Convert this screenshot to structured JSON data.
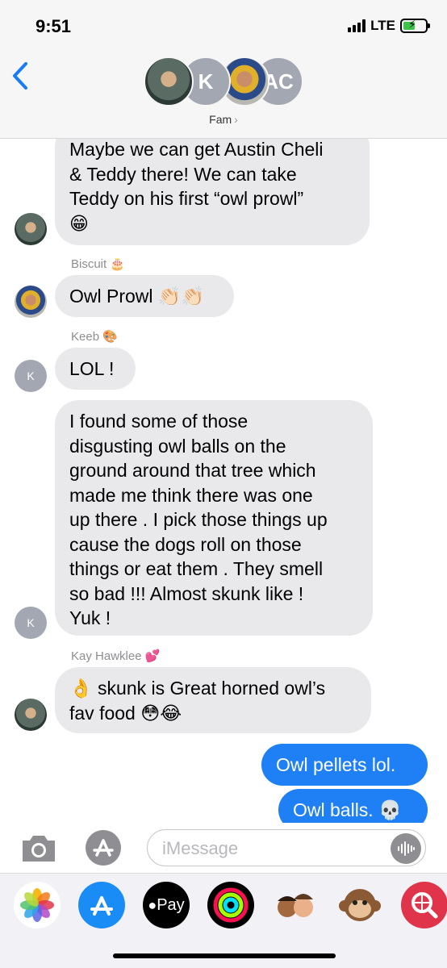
{
  "status_bar": {
    "time": "9:51",
    "network": "LTE",
    "battery_color": "#3ec34a"
  },
  "header": {
    "group_name": "Fam",
    "avatar_initials": [
      "K",
      "AC"
    ]
  },
  "messages": [
    {
      "from": "received",
      "sender_name": "",
      "avatar": "photo-diver",
      "lines": [
        "Maybe we can get Austin Cheli",
        "& Teddy there! We can take",
        "Teddy on his first “owl prowl”",
        "😁"
      ]
    },
    {
      "from": "received",
      "sender_name": "Biscuit 🎂",
      "avatar": "photo-goggles",
      "lines": [
        "Owl Prowl 👏🏻👏🏻"
      ]
    },
    {
      "from": "received",
      "sender_name": "Keeb 🎨",
      "avatar": "K",
      "lines": [
        "LOL !"
      ]
    },
    {
      "from": "received",
      "sender_name": "",
      "avatar": "K",
      "lines": [
        "I found some of those",
        "disgusting owl balls on the",
        "ground around that tree which",
        "made me think there was one",
        "up there . I pick those things up",
        "cause the dogs roll on those",
        "things or eat them . They smell",
        "so bad !!!  Almost skunk like !",
        "Yuk !"
      ]
    },
    {
      "from": "received",
      "sender_name": "Kay Hawklee 💕",
      "avatar": "photo-diver",
      "lines": [
        "👌 skunk is Great horned owl’s",
        "fav food 😳😂"
      ]
    },
    {
      "from": "sent",
      "lines": [
        "Owl pellets lol."
      ]
    },
    {
      "from": "sent",
      "lines": [
        "Owl balls. 💀"
      ]
    }
  ],
  "input_bar": {
    "placeholder": "iMessage"
  },
  "app_drawer": {
    "items": [
      "photos-icon",
      "app-store-icon",
      "apple-pay-icon",
      "activity-icon",
      "memoji-icon",
      "animoji-monkey-icon",
      "web-search-icon"
    ],
    "apple_pay_label": "Pay"
  }
}
